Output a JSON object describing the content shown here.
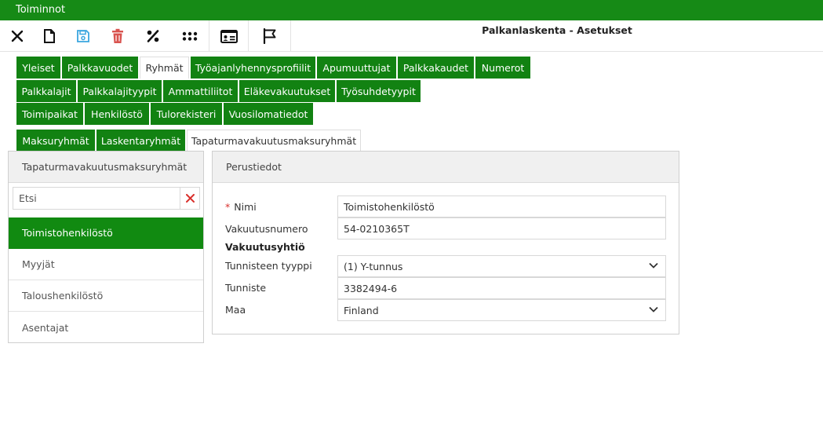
{
  "topbar": {
    "title": "Toiminnot"
  },
  "toolbar": {
    "app_title": "Palkanlaskenta - Asetukset",
    "buttons": [
      {
        "name": "close",
        "icon": "close-icon"
      },
      {
        "name": "new",
        "icon": "document-icon"
      },
      {
        "name": "save",
        "icon": "save-icon"
      },
      {
        "name": "delete",
        "icon": "trash-icon"
      },
      {
        "name": "percent",
        "icon": "percent-icon"
      },
      {
        "name": "apps",
        "icon": "grid-icon"
      },
      {
        "name": "card",
        "icon": "id-card-icon"
      },
      {
        "name": "flag",
        "icon": "flag-icon"
      }
    ]
  },
  "tabs": {
    "row1": [
      "Yleiset",
      "Palkkavuodet",
      "Ryhmät",
      "Työajanlyhennysprofiilit",
      "Apumuuttujat",
      "Palkkakaudet",
      "Numerot"
    ],
    "row2": [
      "Palkkalajit",
      "Palkkalajityypit",
      "Ammattiliitot",
      "Eläkevakuutukset",
      "Työsuhdetyypit"
    ],
    "row3": [
      "Toimipaikat",
      "Henkilöstö",
      "Tulorekisteri",
      "Vuosilomatiedot"
    ],
    "row4": [
      "Maksuryhmät",
      "Laskentaryhmät",
      "Tapaturmavakuutusmaksuryhmät"
    ],
    "active_main": "Ryhmät",
    "active_sub": "Tapaturmavakuutusmaksuryhmät"
  },
  "left_panel": {
    "title": "Tapaturmavakuutusmaksuryhmät",
    "search_placeholder": "Etsi",
    "items": [
      "Toimistohenkilöstö",
      "Myyjät",
      "Taloushenkilöstö",
      "Asentajat"
    ],
    "selected": "Toimistohenkilöstö"
  },
  "right_panel": {
    "title": "Perustiedot",
    "name_label": "Nimi",
    "name_value": "Toimistohenkilöstö",
    "insurance_number_label": "Vakuutusnumero",
    "insurance_number_value": "54-0210365T",
    "company_section": "Vakuutusyhtiö",
    "id_type_label": "Tunnisteen tyyppi",
    "id_type_value": "(1) Y-tunnus",
    "id_label": "Tunniste",
    "id_value": "3382494-6",
    "country_label": "Maa",
    "country_value": "Finland"
  },
  "colors": {
    "brand_green": "#168a16",
    "tab_green": "#128212",
    "required_red": "#d9302c",
    "save_blue": "#3aa6df",
    "delete_red": "#d9534f"
  }
}
